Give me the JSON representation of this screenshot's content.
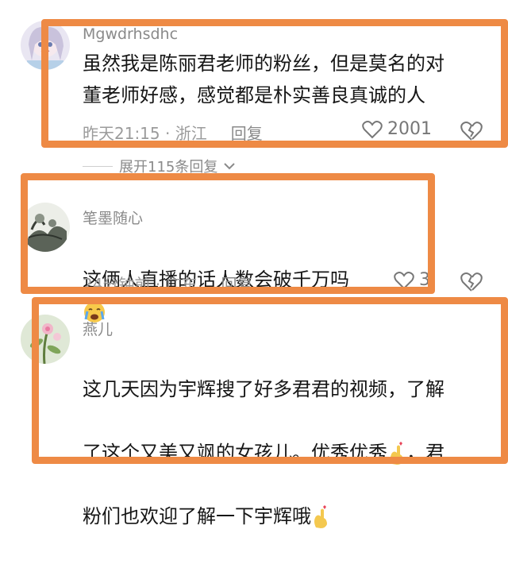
{
  "comments": [
    {
      "username": "Mgwdrhsdhc",
      "text": "虽然我是陈丽君老师的粉丝，但是莫名的对\n董老师好感，感觉都是朴实善良真诚的人",
      "time_location": "昨天21:15 · 浙江",
      "reply_label": "回复",
      "likes": "2001",
      "avatar_icon": "anime-girl-avatar-icon"
    },
    {
      "username": "笔墨随心",
      "text": "这俩人直播的话人数会破千万吗",
      "time_location": "24分钟前 · 广东",
      "reply_label": "回复",
      "likes": "3",
      "avatar_icon": "ink-painting-avatar-icon"
    },
    {
      "username": "燕儿",
      "line1": "这几天因为宇辉搜了好多君君的视频，了解",
      "line2_a": "了这个又美又飒的女孩儿。优秀优秀",
      "line2_b": "，君",
      "line3": "粉们也欢迎了解一下宇辉哦",
      "avatar_icon": "flower-avatar-icon"
    }
  ],
  "expand_replies": "展开115条回复",
  "highlight_color": "#ee8a45"
}
